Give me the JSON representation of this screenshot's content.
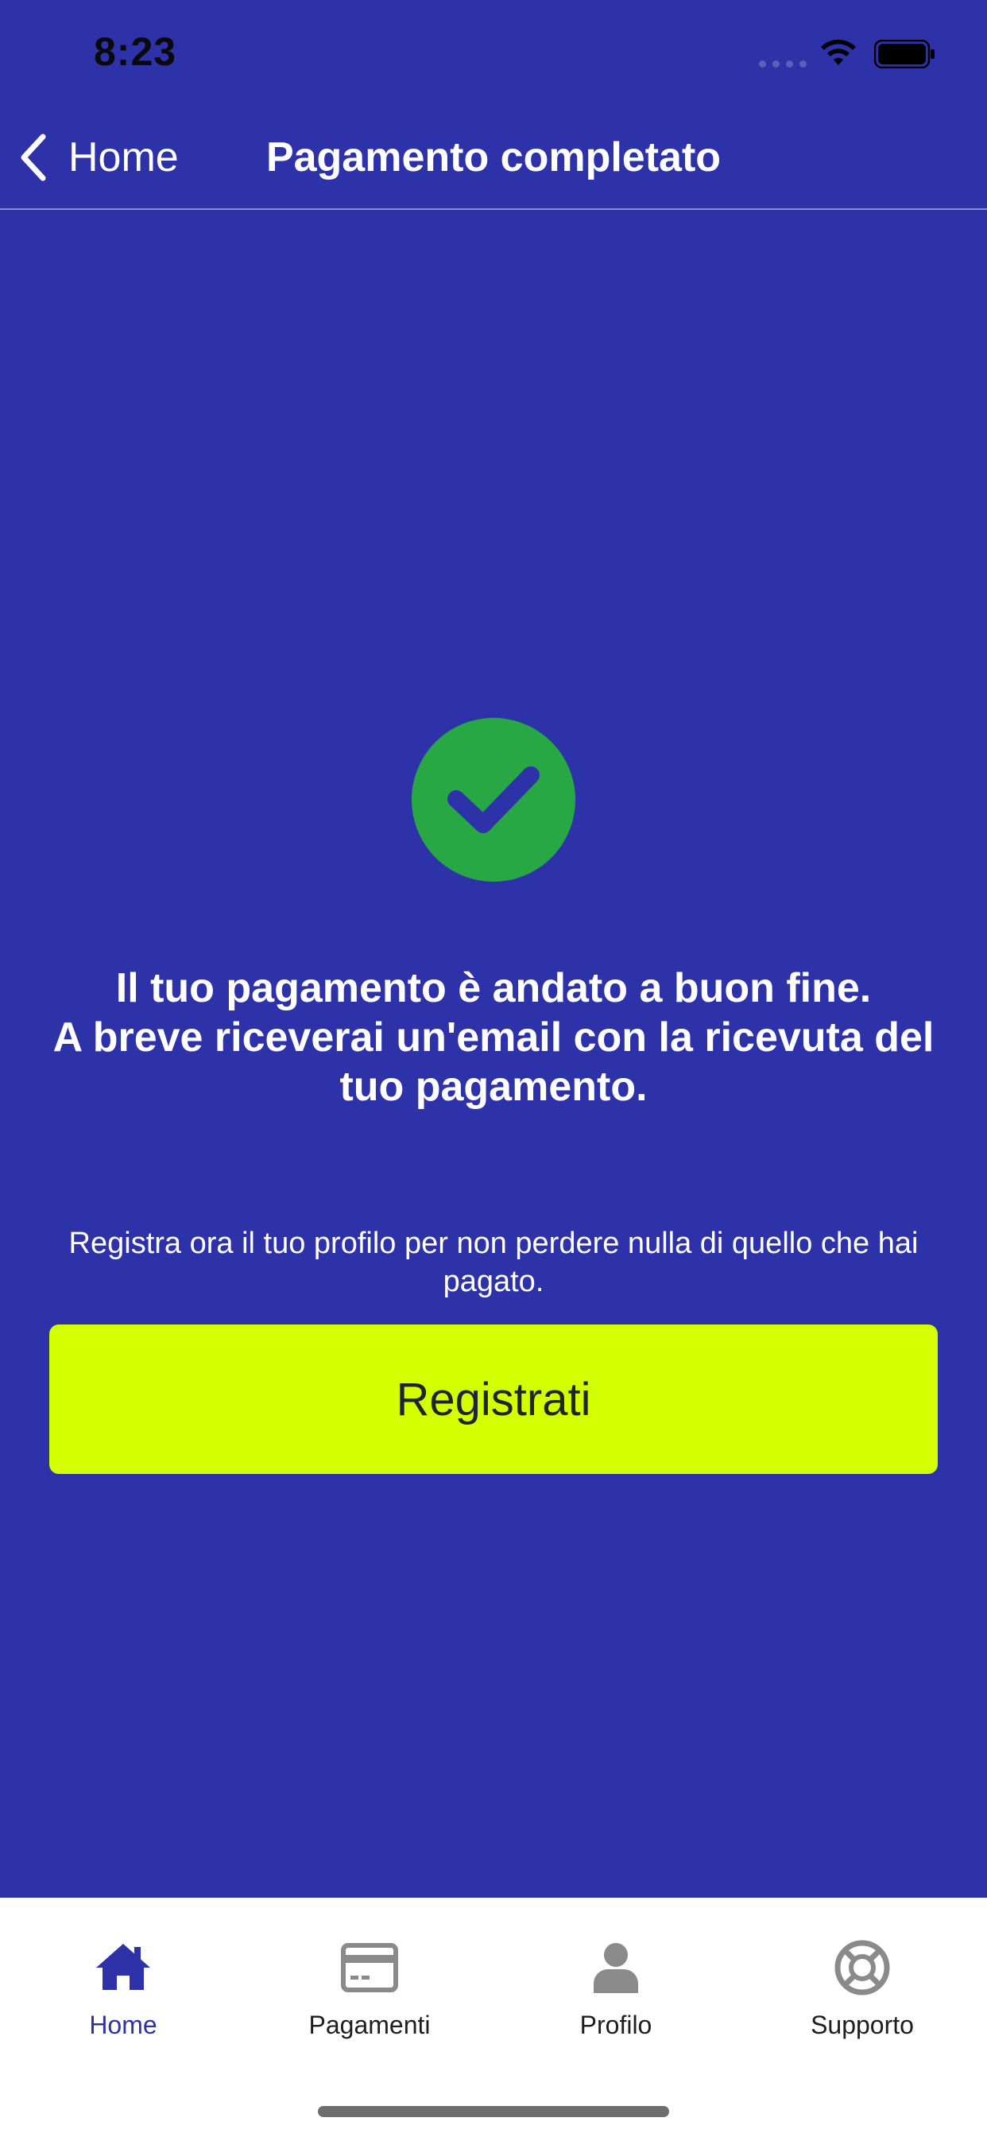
{
  "status_bar": {
    "time": "8:23"
  },
  "nav": {
    "back_label": "Home",
    "title": "Pagamento completato"
  },
  "main": {
    "success_message": "Il tuo pagamento è andato a buon fine.\nA breve riceverai un'email con la ricevuta del tuo pagamento.",
    "register_hint": "Registra ora il tuo profilo per non perdere nulla di quello che hai pagato.",
    "register_button": "Registrati"
  },
  "tabs": [
    {
      "label": "Home",
      "icon": "house-icon",
      "active": true
    },
    {
      "label": "Pagamenti",
      "icon": "credit-card-icon",
      "active": false
    },
    {
      "label": "Profilo",
      "icon": "person-icon",
      "active": false
    },
    {
      "label": "Supporto",
      "icon": "lifebuoy-icon",
      "active": false
    }
  ],
  "colors": {
    "background": "#2d32a8",
    "accent_button": "#d4ff00",
    "success": "#28a745",
    "tab_active": "#2d32a8",
    "tab_inactive": "#8a8a8a"
  }
}
